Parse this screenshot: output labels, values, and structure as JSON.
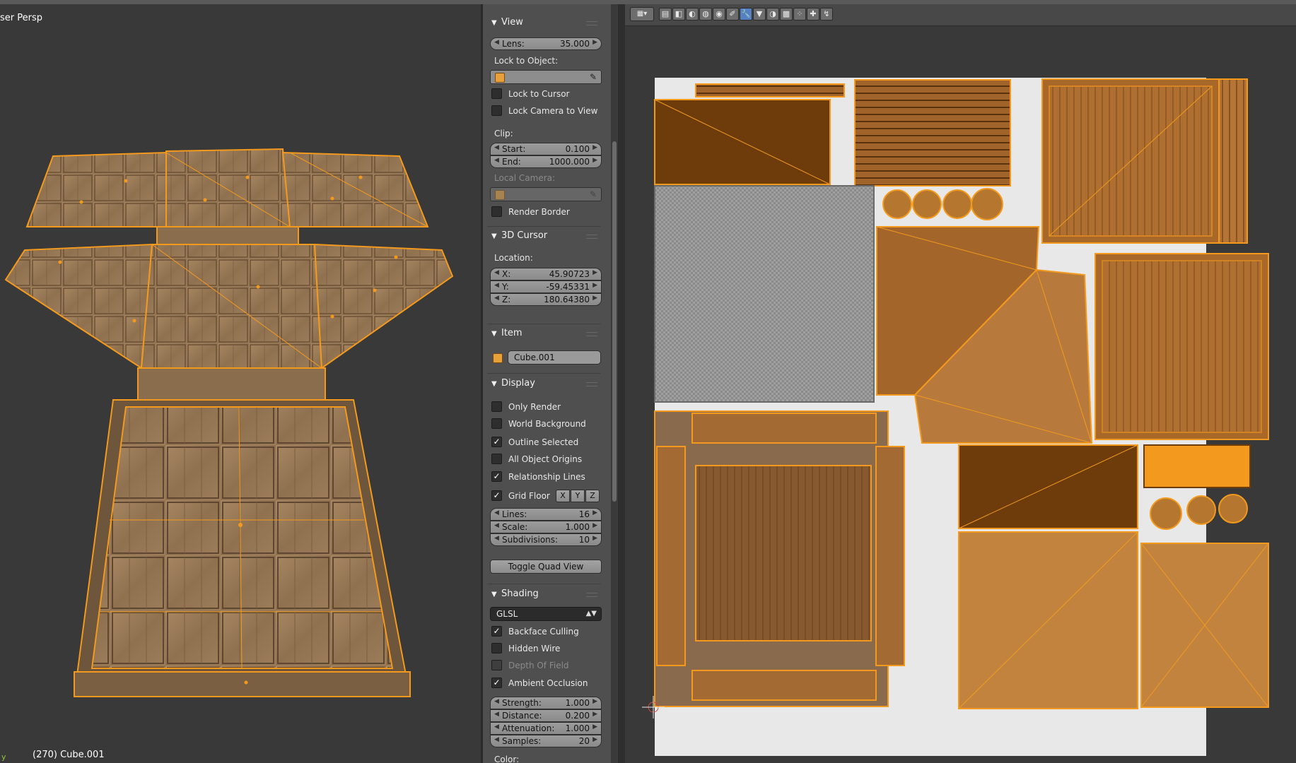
{
  "viewport": {
    "view_label": "ser Persp",
    "status": "(270) Cube.001",
    "axis": "y"
  },
  "panels": {
    "view": {
      "title": "View",
      "lens_label": "Lens:",
      "lens_value": "35.000",
      "lock_to_object_label": "Lock to Object:",
      "lock_to_cursor": "Lock to Cursor",
      "lock_camera_to_view": "Lock Camera to View",
      "clip_label": "Clip:",
      "clip_start_label": "Start:",
      "clip_start_value": "0.100",
      "clip_end_label": "End:",
      "clip_end_value": "1000.000",
      "local_camera_label": "Local Camera:",
      "render_border": "Render Border"
    },
    "cursor": {
      "title": "3D Cursor",
      "location_label": "Location:",
      "x_label": "X:",
      "x_value": "45.90723",
      "y_label": "Y:",
      "y_value": "-59.45331",
      "z_label": "Z:",
      "z_value": "180.64380"
    },
    "item": {
      "title": "Item",
      "name": "Cube.001"
    },
    "display": {
      "title": "Display",
      "only_render": "Only Render",
      "world_background": "World Background",
      "outline_selected": "Outline Selected",
      "all_object_origins": "All Object Origins",
      "relationship_lines": "Relationship Lines",
      "grid_floor": "Grid Floor",
      "axis_x": "X",
      "axis_y": "Y",
      "axis_z": "Z",
      "lines_label": "Lines:",
      "lines_value": "16",
      "scale_label": "Scale:",
      "scale_value": "1.000",
      "subdivisions_label": "Subdivisions:",
      "subdivisions_value": "10",
      "toggle_quad_view": "Toggle Quad View"
    },
    "shading": {
      "title": "Shading",
      "mode": "GLSL",
      "backface_culling": "Backface Culling",
      "hidden_wire": "Hidden Wire",
      "depth_of_field": "Depth Of Field",
      "ambient_occlusion": "Ambient Occlusion",
      "strength_label": "Strength:",
      "strength_value": "1.000",
      "distance_label": "Distance:",
      "distance_value": "0.200",
      "attenuation_label": "Attenuation:",
      "attenuation_value": "1.000",
      "samples_label": "Samples:",
      "samples_value": "20",
      "color_label": "Color:"
    }
  },
  "checkboxes": {
    "lock_to_cursor": false,
    "lock_camera_to_view": false,
    "render_border": false,
    "only_render": false,
    "world_background": false,
    "outline_selected": true,
    "all_object_origins": false,
    "relationship_lines": true,
    "grid_floor": true,
    "backface_culling": true,
    "hidden_wire": false,
    "depth_of_field": false,
    "ambient_occlusion": true
  },
  "colors": {
    "selection_orange": "#f39a1e",
    "wood_texture": "#9b7a57",
    "uv_dark_island": "#6e3c0a",
    "uv_mid_island": "#b5772f",
    "panel_bg": "#4f4f4f",
    "viewport_bg": "#393939",
    "active_tool_blue": "#5680c2"
  },
  "uv_toolbar": {
    "icons": [
      "mode-icon",
      "image-icon",
      "render-icon",
      "texture-icon",
      "world-icon",
      "object-icon",
      "constraint-icon",
      "modifier-icon",
      "data-icon",
      "material-icon",
      "checker-icon",
      "particles-icon",
      "physics-icon"
    ],
    "active_index": 6
  }
}
